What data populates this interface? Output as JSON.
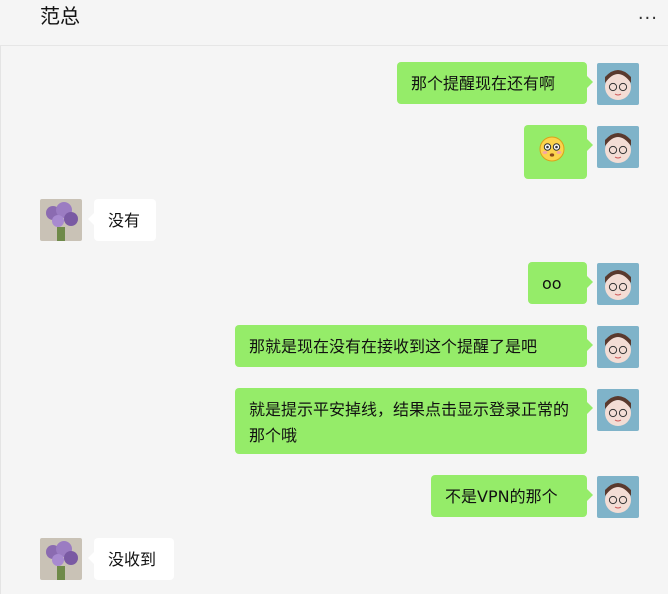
{
  "chat": {
    "title": "范总",
    "more": "···"
  },
  "messages": [
    {
      "from": "me",
      "text": "那个提醒现在还有啊"
    },
    {
      "from": "me",
      "emoji": "flushed-face-emoji"
    },
    {
      "from": "other",
      "text": "没有"
    },
    {
      "from": "me",
      "text": "oo"
    },
    {
      "from": "me",
      "text": "那就是现在没有在接收到这个提醒了是吧"
    },
    {
      "from": "me",
      "text": "就是提示平安掉线，结果点击显示登录正常的那个哦"
    },
    {
      "from": "me",
      "text": "不是VPN的那个"
    },
    {
      "from": "other",
      "text": "没收到"
    }
  ],
  "colors": {
    "me_bubble": "#95ec69",
    "other_bubble": "#ffffff",
    "background": "#f5f5f5"
  }
}
